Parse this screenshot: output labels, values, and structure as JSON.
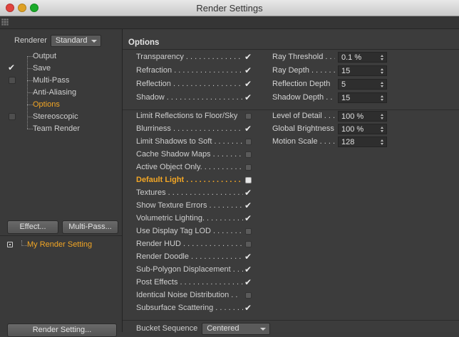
{
  "window": {
    "title": "Render Settings"
  },
  "left_panel": {
    "renderer_label": "Renderer",
    "renderer_value": "Standard",
    "tree": [
      {
        "label": "Output",
        "state": "none",
        "active": false
      },
      {
        "label": "Save",
        "state": "checked",
        "active": false
      },
      {
        "label": "Multi-Pass",
        "state": "off",
        "active": false
      },
      {
        "label": "Anti-Aliasing",
        "state": "none",
        "active": false
      },
      {
        "label": "Options",
        "state": "none",
        "active": true
      },
      {
        "label": "Stereoscopic",
        "state": "off",
        "active": false
      },
      {
        "label": "Team Render",
        "state": "none",
        "active": false
      }
    ],
    "effect_button": "Effect...",
    "multipass_button": "Multi-Pass...",
    "render_setting_item": "My Render Setting",
    "render_setting_button": "Render Setting..."
  },
  "options": {
    "header": "Options",
    "group1": [
      {
        "label": "Transparency . . . . . . . . . . . . . .",
        "state": "checked"
      },
      {
        "label": "Refraction . . . . . . . . . . . . . . . . .",
        "state": "checked"
      },
      {
        "label": "Reflection . . . . . . . . . . . . . . . . .",
        "state": "checked"
      },
      {
        "label": "Shadow . . . . . . . . . . . . . . . . . . .",
        "state": "checked"
      }
    ],
    "group2": [
      {
        "label": "Limit Reflections to Floor/Sky",
        "state": "off",
        "highlight": false
      },
      {
        "label": "Blurriness . . . . . . . . . . . . . . . . .",
        "state": "checked",
        "highlight": false
      },
      {
        "label": "Limit Shadows to Soft . . . . . . . .",
        "state": "off",
        "highlight": false
      },
      {
        "label": "Cache Shadow Maps . . . . . . . . .",
        "state": "off",
        "highlight": false
      },
      {
        "label": "Active Object Only. . . . . . . . . .",
        "state": "off",
        "highlight": false
      },
      {
        "label": "Default Light . . . . . . . . . . . . .",
        "state": "white",
        "highlight": true
      },
      {
        "label": "Textures . . . . . . . . . . . . . . . . . .",
        "state": "checked",
        "highlight": false
      },
      {
        "label": "Show Texture Errors . . . . . . . . .",
        "state": "checked",
        "highlight": false
      },
      {
        "label": "Volumetric Lighting. . . . . . . . . .",
        "state": "checked",
        "highlight": false
      },
      {
        "label": "Use Display Tag LOD . . . . . . . .",
        "state": "off",
        "highlight": false
      },
      {
        "label": "Render HUD . . . . . . . . . . . . . . .",
        "state": "off",
        "highlight": false
      },
      {
        "label": "Render Doodle . . . . . . . . . . . . .",
        "state": "checked",
        "highlight": false
      },
      {
        "label": "Sub-Polygon Displacement . . .",
        "state": "checked",
        "highlight": false
      },
      {
        "label": "Post Effects . . . . . . . . . . . . . . .",
        "state": "checked",
        "highlight": false
      },
      {
        "label": "Identical Noise Distribution . .",
        "state": "off",
        "highlight": false
      },
      {
        "label": "Subsurface Scattering . . . . . . . .",
        "state": "checked",
        "highlight": false
      }
    ],
    "params1": [
      {
        "label": "Ray Threshold . . .",
        "value": "0.1 %"
      },
      {
        "label": "Ray Depth . . . . . .",
        "value": "15"
      },
      {
        "label": "Reflection Depth",
        "value": "5"
      },
      {
        "label": "Shadow Depth . . .",
        "value": "15"
      }
    ],
    "params2": [
      {
        "label": "Level of Detail . . .",
        "value": "100 %"
      },
      {
        "label": "Global Brightness",
        "value": "100 %"
      },
      {
        "label": "Motion Scale . . . .",
        "value": "128"
      }
    ],
    "bucket_label": "Bucket Sequence",
    "bucket_value": "Centered"
  }
}
